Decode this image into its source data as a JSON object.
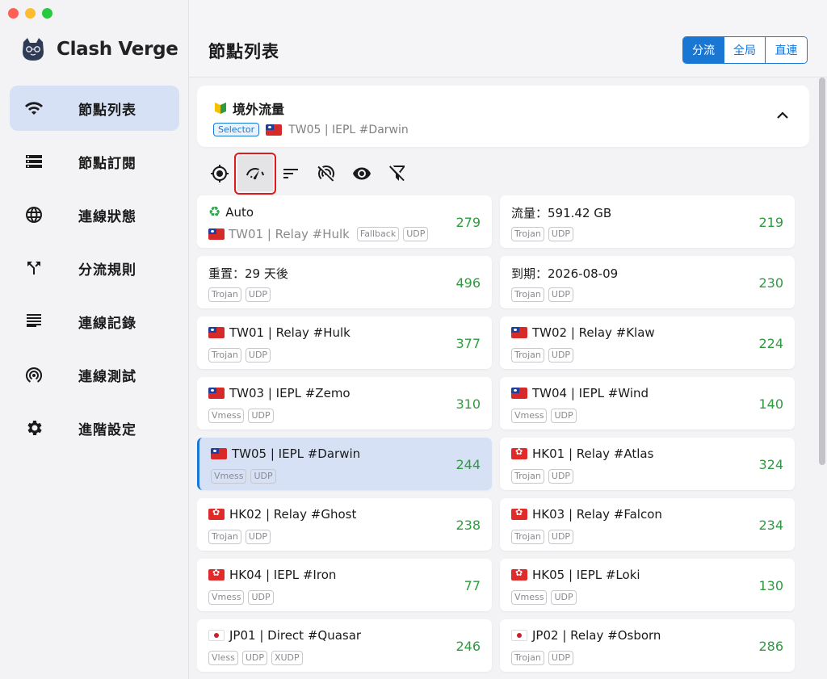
{
  "app": {
    "name": "Clash Verge"
  },
  "sidebar": {
    "items": [
      {
        "label": "節點列表",
        "icon": "wifi-icon",
        "active": true
      },
      {
        "label": "節點訂閱",
        "icon": "storage-icon",
        "active": false
      },
      {
        "label": "連線狀態",
        "icon": "globe-icon",
        "active": false
      },
      {
        "label": "分流規則",
        "icon": "fork-icon",
        "active": false
      },
      {
        "label": "連線記錄",
        "icon": "list-icon",
        "active": false
      },
      {
        "label": "連線測試",
        "icon": "radar-icon",
        "active": false
      },
      {
        "label": "進階設定",
        "icon": "gear-icon",
        "active": false
      }
    ]
  },
  "header": {
    "title": "節點列表",
    "modes": [
      "分流",
      "全局",
      "直連"
    ],
    "active_mode": "分流"
  },
  "group": {
    "title": "境外流量",
    "type": "Selector",
    "current": "TW05 | IEPL #Darwin"
  },
  "toolbar": [
    "locate-icon",
    "speed-test-icon",
    "sort-icon",
    "filter-delay-icon",
    "eye-icon",
    "filter-off-icon"
  ],
  "proxies": [
    {
      "name": "Auto",
      "flag": "",
      "special": "auto",
      "sub_name": "TW01 | Relay #Hulk",
      "tags": [
        "Fallback",
        "UDP"
      ],
      "delay": "279"
    },
    {
      "name": "流量：591.42 GB",
      "flag": "",
      "tags": [
        "Trojan",
        "UDP"
      ],
      "delay": "219"
    },
    {
      "name": "重置：29 天後",
      "flag": "",
      "tags": [
        "Trojan",
        "UDP"
      ],
      "delay": "496"
    },
    {
      "name": "到期：2026-08-09",
      "flag": "",
      "tags": [
        "Trojan",
        "UDP"
      ],
      "delay": "230"
    },
    {
      "name": "TW01 | Relay #Hulk",
      "flag": "tw",
      "tags": [
        "Trojan",
        "UDP"
      ],
      "delay": "377"
    },
    {
      "name": "TW02 | Relay #Klaw",
      "flag": "tw",
      "tags": [
        "Trojan",
        "UDP"
      ],
      "delay": "224"
    },
    {
      "name": "TW03 | IEPL #Zemo",
      "flag": "tw",
      "tags": [
        "Vmess",
        "UDP"
      ],
      "delay": "310"
    },
    {
      "name": "TW04 | IEPL #Wind",
      "flag": "tw",
      "tags": [
        "Vmess",
        "UDP"
      ],
      "delay": "140"
    },
    {
      "name": "TW05 | IEPL #Darwin",
      "flag": "tw",
      "tags": [
        "Vmess",
        "UDP"
      ],
      "delay": "244",
      "selected": true
    },
    {
      "name": "HK01 | Relay #Atlas",
      "flag": "hk",
      "tags": [
        "Trojan",
        "UDP"
      ],
      "delay": "324"
    },
    {
      "name": "HK02 | Relay #Ghost",
      "flag": "hk",
      "tags": [
        "Trojan",
        "UDP"
      ],
      "delay": "238"
    },
    {
      "name": "HK03 | Relay #Falcon",
      "flag": "hk",
      "tags": [
        "Trojan",
        "UDP"
      ],
      "delay": "234"
    },
    {
      "name": "HK04 | IEPL #Iron",
      "flag": "hk",
      "tags": [
        "Vmess",
        "UDP"
      ],
      "delay": "77"
    },
    {
      "name": "HK05 | IEPL #Loki",
      "flag": "hk",
      "tags": [
        "Vmess",
        "UDP"
      ],
      "delay": "130"
    },
    {
      "name": "JP01 | Direct #Quasar",
      "flag": "jp",
      "tags": [
        "Vless",
        "UDP",
        "XUDP"
      ],
      "delay": "246"
    },
    {
      "name": "JP02 | Relay #Osborn",
      "flag": "jp",
      "tags": [
        "Trojan",
        "UDP"
      ],
      "delay": "286"
    }
  ],
  "colors": {
    "accent": "#1976d2",
    "delay_good": "#2e9b3f",
    "selected_bg": "#d6e1f6"
  }
}
